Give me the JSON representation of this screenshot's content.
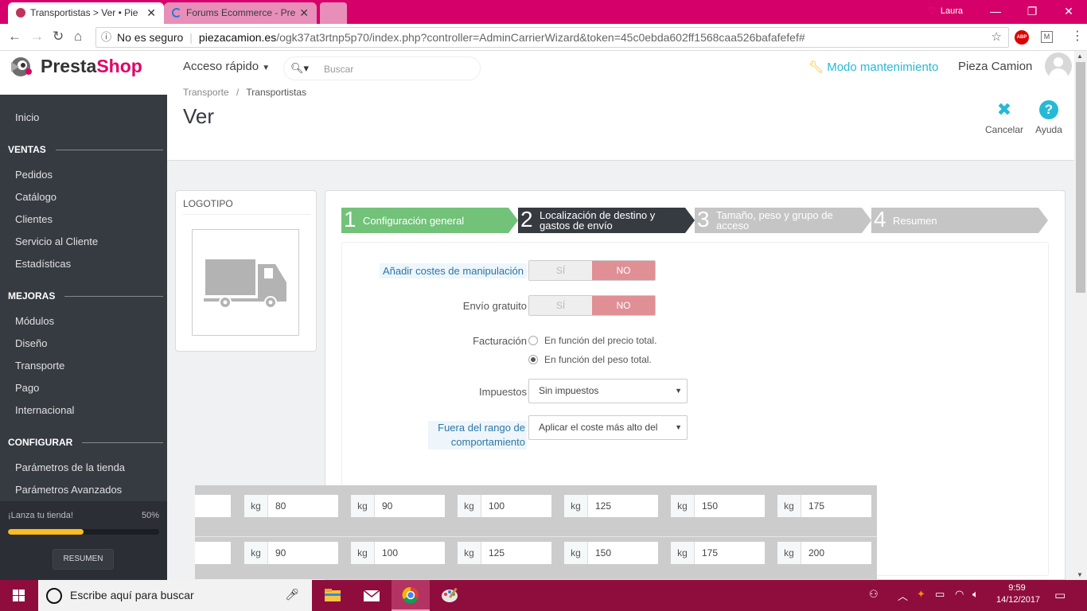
{
  "browser": {
    "tabs": [
      {
        "title": "Transportistas > Ver • Pie",
        "close": "✕"
      },
      {
        "title": "Forums Ecommerce - Pre",
        "close": "✕"
      }
    ],
    "user": "Laura",
    "security": "No es seguro",
    "url_host": "piezacamion.es",
    "url_path": "/ogk37at3rtnp5p70/index.php?controller=AdminCarrierWizard&token=45c0ebda602ff1568caa526bafafefef#",
    "ext_abp": "ABP",
    "ext_m": "M"
  },
  "header": {
    "logo_prefix": "Presta",
    "logo_suffix": "Shop",
    "quick_access": "Acceso rápido",
    "search_placeholder": "Buscar",
    "maintenance": "Modo mantenimiento",
    "shop_name": "Pieza Camion"
  },
  "sidebar": {
    "home": "Inicio",
    "sections": [
      {
        "title": "VENTAS",
        "items": [
          "Pedidos",
          "Catálogo",
          "Clientes",
          "Servicio al Cliente",
          "Estadísticas"
        ]
      },
      {
        "title": "MEJORAS",
        "items": [
          "Módulos",
          "Diseño",
          "Transporte",
          "Pago",
          "Internacional"
        ]
      },
      {
        "title": "CONFIGURAR",
        "items": [
          "Parámetros de la tienda",
          "Parámetros Avanzados"
        ]
      }
    ],
    "launch_label": "¡Lanza tu tienda!",
    "launch_percent_text": "50%",
    "launch_progress": 0.5,
    "summary_button": "RESUMEN"
  },
  "page": {
    "breadcrumb": [
      "Transporte",
      "Transportistas"
    ],
    "breadcrumb_sep": "/",
    "title": "Ver",
    "actions": {
      "cancel": "Cancelar",
      "help": "Ayuda"
    }
  },
  "logo_panel": {
    "title": "LOGOTIPO"
  },
  "wizard": {
    "steps": [
      {
        "num": "1",
        "label": "Configuración general",
        "state": "done",
        "color": "#72c279"
      },
      {
        "num": "2",
        "label": "Localización de destino y gastos de envío",
        "state": "current",
        "color": "#363a41"
      },
      {
        "num": "3",
        "label": "Tamaño, peso y grupo de acceso",
        "state": "todo",
        "color": "#c5c5c5"
      },
      {
        "num": "4",
        "label": "Resumen",
        "state": "todo",
        "color": "#c5c5c5"
      }
    ],
    "handling_label": "Añadir costes de manipulación",
    "free_shipping_label": "Envío gratuito",
    "yes": "SÍ",
    "no": "NO",
    "billing_label": "Facturación",
    "billing_options": [
      "En función del precio total.",
      "En función del peso total."
    ],
    "billing_selected": 1,
    "tax_label": "Impuestos",
    "tax_value": "Sin impuestos",
    "out_of_range_label": "Fuera del rango de comportamiento",
    "out_of_range_value": "Aplicar el coste más alto del",
    "unit": "kg",
    "range_from": [
      "80",
      "90",
      "100",
      "125",
      "150",
      "175"
    ],
    "range_to": [
      "90",
      "100",
      "125",
      "150",
      "175",
      "200"
    ]
  },
  "taskbar": {
    "search_text": "Escribe aquí para buscar",
    "time": "9:59",
    "date": "14/12/2017"
  },
  "colors": {
    "tabbar": "#d6006b",
    "taskbar": "#8f0d3d",
    "sidebar": "#363a41",
    "accent": "#25b9d7",
    "no_active": "#e08f95"
  }
}
